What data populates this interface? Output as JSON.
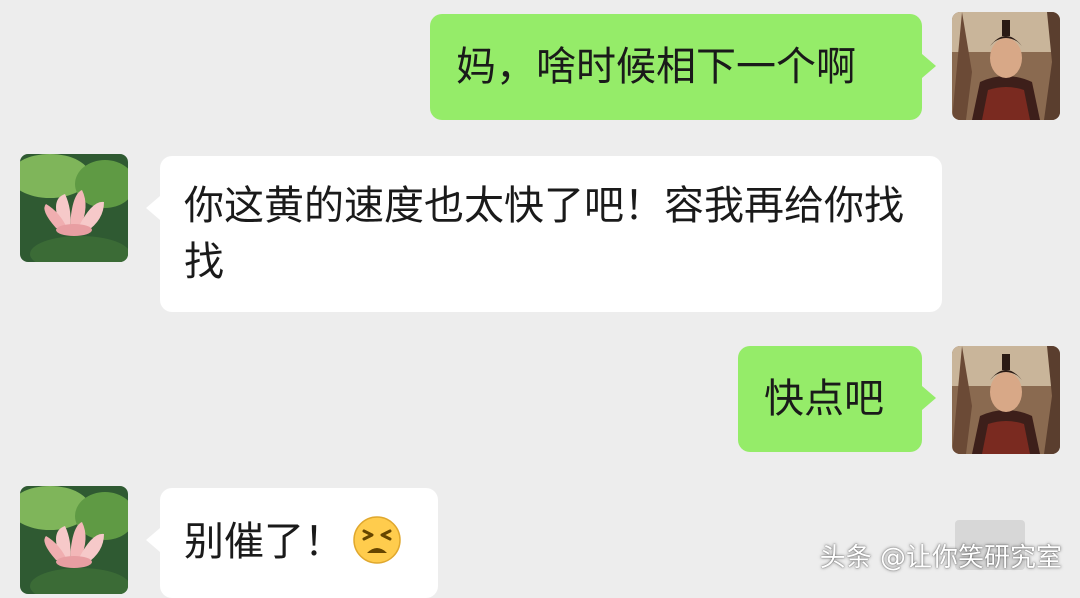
{
  "messages": [
    {
      "side": "right",
      "text": "妈，啥时候相下一个啊"
    },
    {
      "side": "left",
      "text": "你这黄的速度也太快了吧！容我再给你找找"
    },
    {
      "side": "right",
      "text": "快点吧"
    },
    {
      "side": "left",
      "text": "别催了！",
      "emoji": "tired-face-emoji"
    }
  ],
  "avatars": {
    "self": "warrior-portrait-avatar",
    "other": "lotus-flower-avatar"
  },
  "colors": {
    "background": "#ededed",
    "self_bubble": "#95ec69",
    "other_bubble": "#ffffff"
  },
  "watermark": "头条 @让你笑研究室"
}
